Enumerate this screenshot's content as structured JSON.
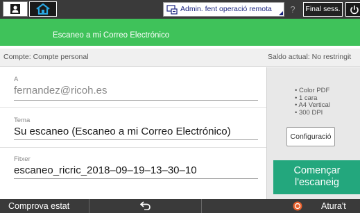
{
  "topbar": {
    "remote_label": "Admin. fent operació remota",
    "help_label": "?",
    "logout_label": "Final sess."
  },
  "header": {
    "title": "Escaneo a mi Correo Electrónico"
  },
  "account": {
    "account_label": "Compte: Compte personal",
    "balance_label": "Saldo actual: No restringit"
  },
  "form": {
    "to": {
      "label": "A",
      "value": "fernandez@ricoh.es"
    },
    "subject": {
      "label": "Tema",
      "value": "Su escaneo (Escaneo a mi Correo Electrónico)"
    },
    "file": {
      "label": "Fitxer",
      "value": "escaneo_ricric_2018–09–19–13–30–10"
    }
  },
  "side": {
    "specs": [
      "• Color PDF",
      "• 1 cara",
      "• A4 Vertical",
      "• 300 DPI"
    ],
    "config_label": "Configuració",
    "start_label_line1": "Començar",
    "start_label_line2": "l'escaneig"
  },
  "bottombar": {
    "status_label": "Comprova estat",
    "stop_label": "Atura't"
  },
  "colors": {
    "title_green": "#3fc25a",
    "start_green": "#23a77d",
    "bar_dark": "#3a3a3a",
    "stop_orange": "#e8602c"
  },
  "icons": {
    "user": "user-icon",
    "home": "home-icon",
    "remote": "remote-operation-icon",
    "power": "power-icon",
    "back": "back-arrow-icon",
    "stop": "stop-icon"
  }
}
